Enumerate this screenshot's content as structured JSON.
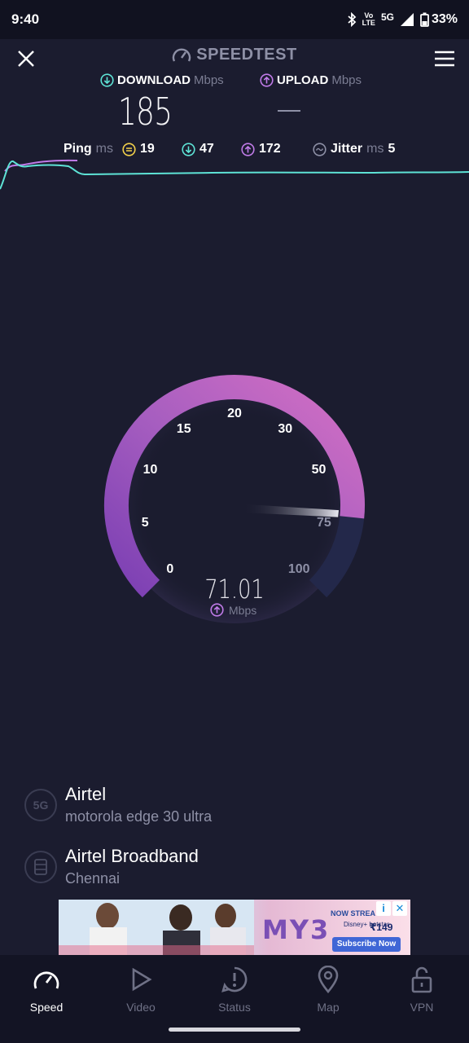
{
  "status_bar": {
    "time": "9:40",
    "volte_top": "Vo",
    "volte_bottom": "LTE",
    "network": "5G",
    "battery": "33%"
  },
  "header": {
    "title": "SPEEDTEST",
    "icons": {
      "close": "close-icon",
      "menu": "menu-icon",
      "logo": "speedometer-icon"
    }
  },
  "download": {
    "label": "DOWNLOAD",
    "unit": "Mbps",
    "value": "185"
  },
  "upload": {
    "label": "UPLOAD",
    "unit": "Mbps",
    "value": "—"
  },
  "ping": {
    "label": "Ping",
    "unit": "ms",
    "idle": "19",
    "download": "47",
    "upload": "172"
  },
  "jitter": {
    "label": "Jitter",
    "unit": "ms",
    "value": "5"
  },
  "gauge": {
    "ticks": [
      "0",
      "5",
      "10",
      "15",
      "20",
      "30",
      "50",
      "75",
      "100"
    ],
    "value": "71.01",
    "unit": "Mbps",
    "current_mbps": 71.01,
    "colors": {
      "arc_start": "#7b3fb3",
      "arc_end": "#d36fc4",
      "arc_track": "#23284a"
    }
  },
  "providers": [
    {
      "badge": "5G",
      "name": "Airtel",
      "detail": "motorola edge 30 ultra"
    },
    {
      "badge": "server",
      "name": "Airtel Broadband",
      "detail": "Chennai"
    }
  ],
  "ad": {
    "brand": "MY3",
    "tagline": "NOW STREA",
    "partner": "Disney+ hotstar",
    "starting": "STARTING",
    "price": "₹149",
    "cta": "Subscribe Now"
  },
  "nav": {
    "items": [
      {
        "label": "Speed",
        "icon": "speedometer-icon"
      },
      {
        "label": "Video",
        "icon": "play-icon"
      },
      {
        "label": "Status",
        "icon": "alert-icon"
      },
      {
        "label": "Map",
        "icon": "map-pin-icon"
      },
      {
        "label": "VPN",
        "icon": "lock-icon"
      }
    ]
  },
  "colors": {
    "background": "#1b1c2f",
    "download_accent": "#5ee3d6",
    "upload_accent": "#c07be8",
    "ping_idle": "#f2d04a"
  }
}
